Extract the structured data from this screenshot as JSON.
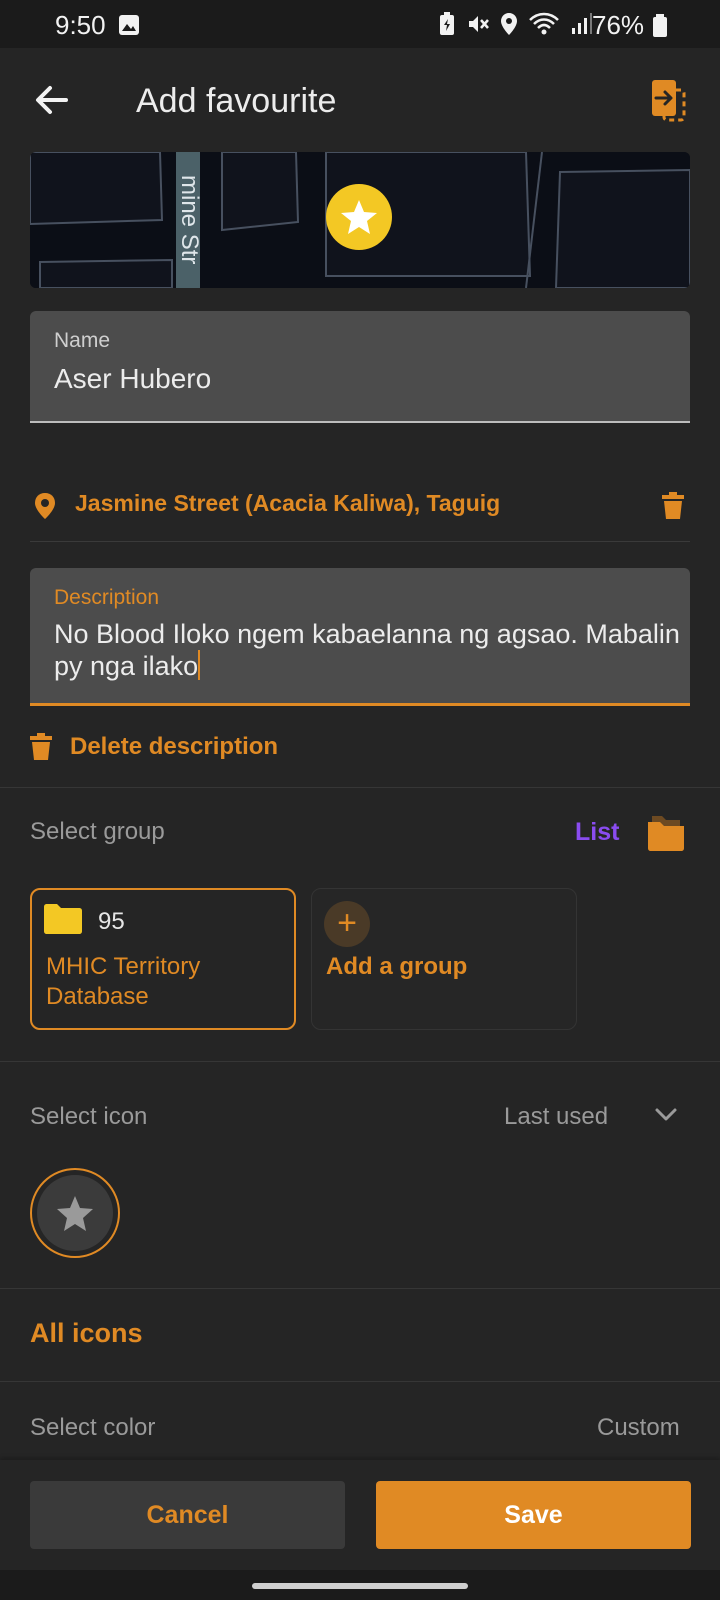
{
  "status_bar": {
    "time": "9:50",
    "battery": "76%"
  },
  "app_bar": {
    "title": "Add favourite",
    "back_icon": "arrow-left",
    "import_icon": "import-file-icon"
  },
  "map": {
    "street_label": "mine Str",
    "marker_icon": "star"
  },
  "name_field": {
    "label": "Name",
    "value": "Aser Hubero"
  },
  "address": {
    "text": "Jasmine Street (Acacia Kaliwa), Taguig"
  },
  "description_field": {
    "label": "Description",
    "value": "No Blood Iloko ngem kabaelanna ng agsao. Mabalin py nga ilako"
  },
  "delete_description": {
    "label": "Delete description"
  },
  "group_section": {
    "label": "Select group",
    "list_link": "List",
    "groups": [
      {
        "count": "95",
        "name": "MHIC Territory Database",
        "selected": true
      }
    ],
    "add_group_label": "Add a group"
  },
  "icon_section": {
    "label": "Select icon",
    "filter": "Last used",
    "selected_icon": "star",
    "all_icons_label": "All icons"
  },
  "color_section": {
    "label": "Select color",
    "value": "Custom"
  },
  "actions": {
    "cancel": "Cancel",
    "save": "Save"
  },
  "colors": {
    "accent": "#e08a24",
    "background": "#252525",
    "field": "#4c4c4c",
    "link": "#8a4cf0",
    "marker": "#f3c824"
  }
}
